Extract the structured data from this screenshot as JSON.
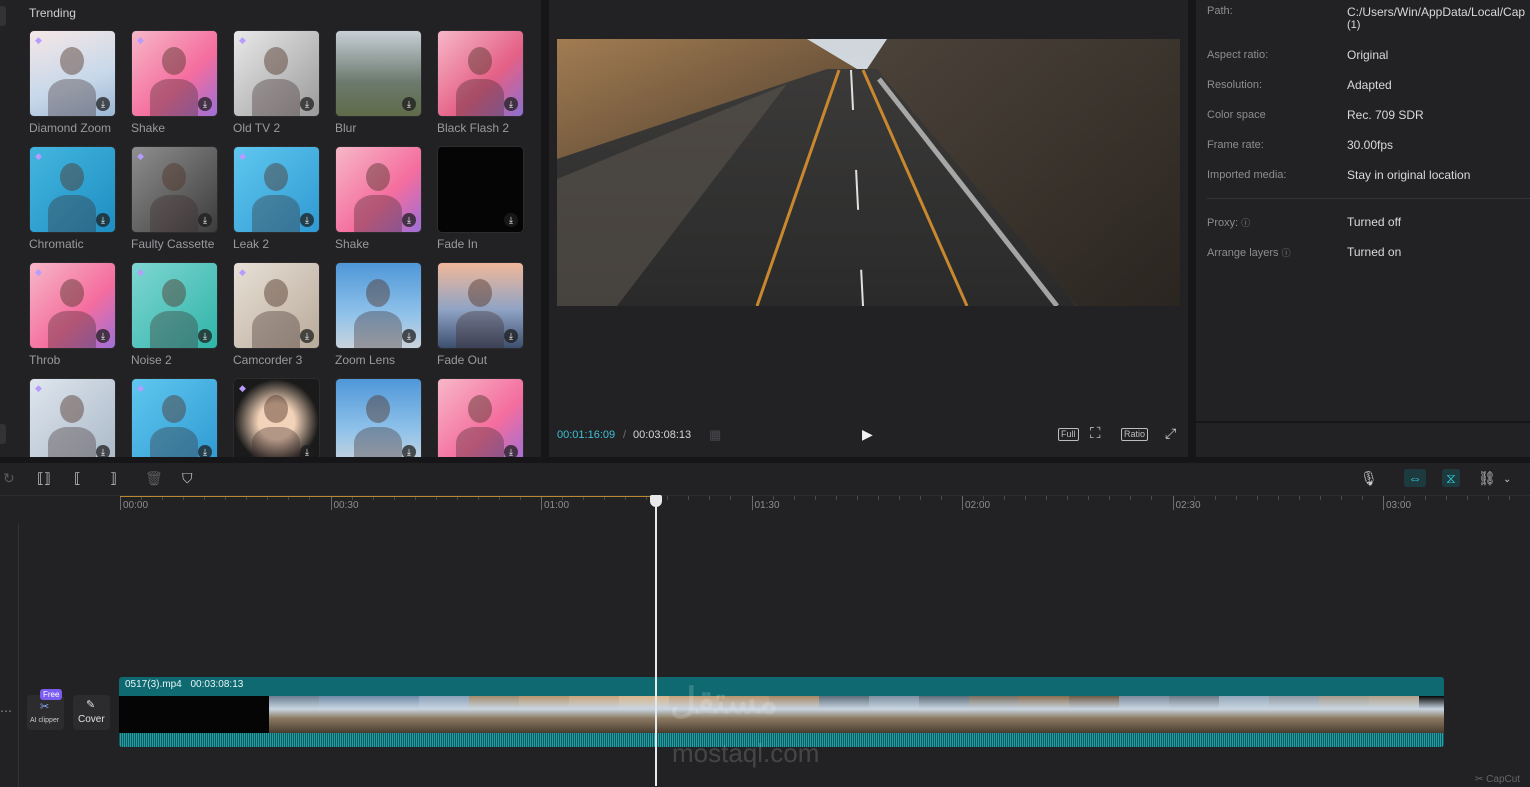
{
  "effects": {
    "heading": "Trending",
    "items": [
      {
        "label": "Diamond Zoom",
        "premium": true,
        "bg": "linear-gradient(160deg,#f6e7e6,#c7d8ea 60%,#9cb7d4)"
      },
      {
        "label": "Shake",
        "premium": true,
        "bg": "linear-gradient(135deg,#f7b7c8,#f46d9e 60%,#9d6fd8)"
      },
      {
        "label": "Old TV 2",
        "premium": true,
        "bg": "linear-gradient(135deg,#e9e9e9,#9a9a9a)"
      },
      {
        "label": "Blur",
        "premium": false,
        "bg": "linear-gradient(180deg,#c8cfd6,#6b7a6e 60%,#5f6b49)"
      },
      {
        "label": "Black Flash 2",
        "premium": false,
        "bg": "linear-gradient(135deg,#f7b7c8,#e46086 60%,#8b6fd0)"
      },
      {
        "label": "Chromatic",
        "premium": true,
        "bg": "linear-gradient(135deg,#43b6df,#1e8ec2)"
      },
      {
        "label": "Faulty Cassette",
        "premium": true,
        "bg": "linear-gradient(135deg,#8e8e8e,#3c3c3c)"
      },
      {
        "label": "Leak 2",
        "premium": true,
        "bg": "linear-gradient(135deg,#5fc7ef,#2f9ad3)"
      },
      {
        "label": "Shake",
        "premium": false,
        "bg": "linear-gradient(135deg,#f7b7c8,#f46d9e 60%,#9d6fd8)"
      },
      {
        "label": "Fade In",
        "premium": false,
        "bg": "#050505"
      },
      {
        "label": "Throb",
        "premium": true,
        "bg": "linear-gradient(135deg,#f7b7c8,#f46d9e 60%,#9d6fd8)"
      },
      {
        "label": "Noise 2",
        "premium": true,
        "bg": "linear-gradient(135deg,#7fd6d2,#2fb4a8)"
      },
      {
        "label": "Camcorder 3",
        "premium": true,
        "bg": "linear-gradient(135deg,#e8e0d6,#b8aa9a)"
      },
      {
        "label": "Zoom Lens",
        "premium": false,
        "bg": "linear-gradient(180deg,#4f97d8,#8fc2ea 60%,#c9d3dc)"
      },
      {
        "label": "Fade Out",
        "premium": false,
        "bg": "linear-gradient(180deg,#f0b89a,#8fa3c4 55%,#3d4f6f)"
      },
      {
        "label": "",
        "premium": true,
        "bg": "linear-gradient(135deg,#dfe6ee,#a9b8c8)"
      },
      {
        "label": "",
        "premium": true,
        "bg": "linear-gradient(135deg,#5fc7ef,#2f9ad3)"
      },
      {
        "label": "",
        "premium": true,
        "bg": "radial-gradient(circle,#f2d2b8 30%,#1a1a1a 70%)"
      },
      {
        "label": "",
        "premium": false,
        "bg": "linear-gradient(180deg,#4f97d8,#8fc2ea 60%,#c9d3dc)"
      },
      {
        "label": "",
        "premium": false,
        "bg": "linear-gradient(135deg,#f7b7c8,#f46d9e 60%,#9d6fd8)"
      }
    ]
  },
  "preview": {
    "current_time": "00:01:16:09",
    "separator": "/",
    "total_time": "00:03:08:13",
    "full_label": "Full",
    "ratio_label": "Ratio"
  },
  "properties": {
    "path_label": "Path:",
    "path_value": "C:/Users/Win/AppData/Local/Cap",
    "path_value2": "(1)",
    "aspect_label": "Aspect ratio:",
    "aspect_value": "Original",
    "resolution_label": "Resolution:",
    "resolution_value": "Adapted",
    "colorspace_label": "Color space",
    "colorspace_value": "Rec. 709 SDR",
    "framerate_label": "Frame rate:",
    "framerate_value": "30.00fps",
    "imported_label": "Imported media:",
    "imported_value": "Stay in original location",
    "proxy_label": "Proxy:",
    "proxy_value": "Turned off",
    "arrange_label": "Arrange layers",
    "arrange_value": "Turned on"
  },
  "timeline": {
    "ticks": [
      "00:00",
      "00:30",
      "01:00",
      "01:30",
      "02:00",
      "02:30",
      "03:00"
    ],
    "clip_name": "0517(3).mp4",
    "clip_duration": "00:03:08:13",
    "free_badge": "Free",
    "ai_clipper": "AI clipper",
    "cover_label": "Cover"
  },
  "watermark": {
    "arabic": "مستقل",
    "latin": "mostaql.com"
  },
  "brand": "CapCut"
}
